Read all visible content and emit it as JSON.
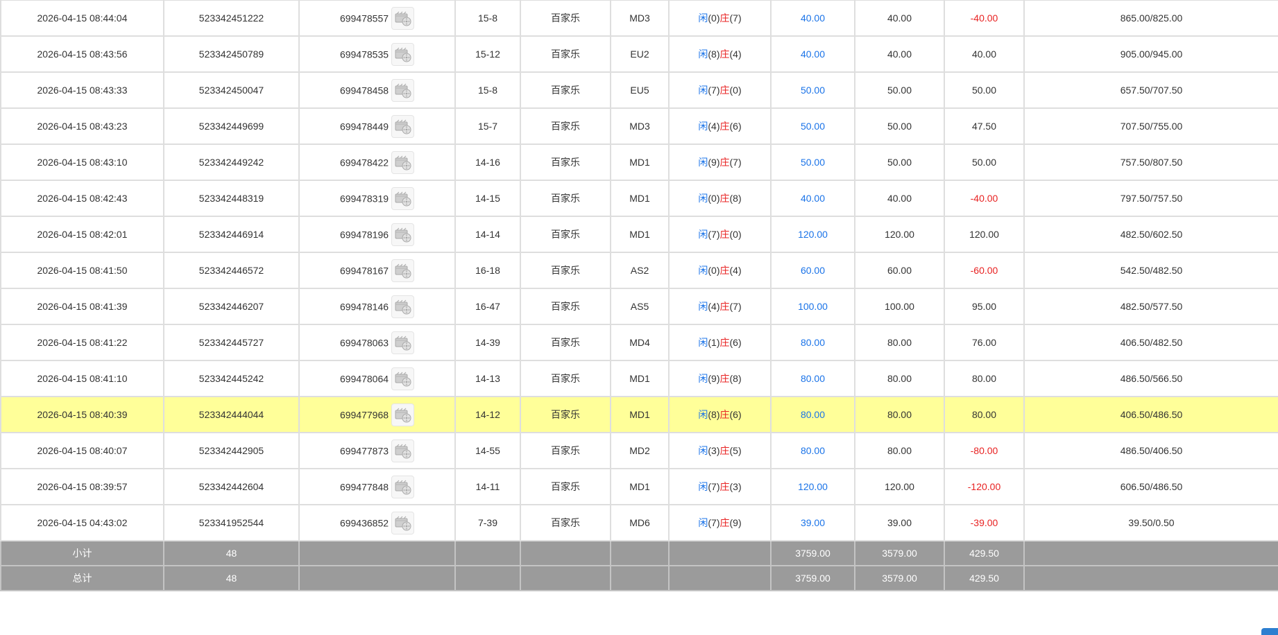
{
  "rows": [
    {
      "time": "2026-04-15 08:44:04",
      "order_id": "523342451222",
      "game_id": "699478557",
      "shoe": "15-8",
      "game": "百家乐",
      "table": "MD3",
      "player_label": "闲",
      "player_score": "(0)",
      "banker_label": "庄",
      "banker_score": "(7)",
      "bet": "40.00",
      "valid_bet": "40.00",
      "win_loss": "-40.00",
      "loss": true,
      "balance": "865.00/825.00"
    },
    {
      "time": "2026-04-15 08:43:56",
      "order_id": "523342450789",
      "game_id": "699478535",
      "shoe": "15-12",
      "game": "百家乐",
      "table": "EU2",
      "player_label": "闲",
      "player_score": "(8)",
      "banker_label": "庄",
      "banker_score": "(4)",
      "bet": "40.00",
      "valid_bet": "40.00",
      "win_loss": "40.00",
      "loss": false,
      "balance": "905.00/945.00"
    },
    {
      "time": "2026-04-15 08:43:33",
      "order_id": "523342450047",
      "game_id": "699478458",
      "shoe": "15-8",
      "game": "百家乐",
      "table": "EU5",
      "player_label": "闲",
      "player_score": "(7)",
      "banker_label": "庄",
      "banker_score": "(0)",
      "bet": "50.00",
      "valid_bet": "50.00",
      "win_loss": "50.00",
      "loss": false,
      "balance": "657.50/707.50"
    },
    {
      "time": "2026-04-15 08:43:23",
      "order_id": "523342449699",
      "game_id": "699478449",
      "shoe": "15-7",
      "game": "百家乐",
      "table": "MD3",
      "player_label": "闲",
      "player_score": "(4)",
      "banker_label": "庄",
      "banker_score": "(6)",
      "bet": "50.00",
      "valid_bet": "50.00",
      "win_loss": "47.50",
      "loss": false,
      "balance": "707.50/755.00"
    },
    {
      "time": "2026-04-15 08:43:10",
      "order_id": "523342449242",
      "game_id": "699478422",
      "shoe": "14-16",
      "game": "百家乐",
      "table": "MD1",
      "player_label": "闲",
      "player_score": "(9)",
      "banker_label": "庄",
      "banker_score": "(7)",
      "bet": "50.00",
      "valid_bet": "50.00",
      "win_loss": "50.00",
      "loss": false,
      "balance": "757.50/807.50"
    },
    {
      "time": "2026-04-15 08:42:43",
      "order_id": "523342448319",
      "game_id": "699478319",
      "shoe": "14-15",
      "game": "百家乐",
      "table": "MD1",
      "player_label": "闲",
      "player_score": "(0)",
      "banker_label": "庄",
      "banker_score": "(8)",
      "bet": "40.00",
      "valid_bet": "40.00",
      "win_loss": "-40.00",
      "loss": true,
      "balance": "797.50/757.50"
    },
    {
      "time": "2026-04-15 08:42:01",
      "order_id": "523342446914",
      "game_id": "699478196",
      "shoe": "14-14",
      "game": "百家乐",
      "table": "MD1",
      "player_label": "闲",
      "player_score": "(7)",
      "banker_label": "庄",
      "banker_score": "(0)",
      "bet": "120.00",
      "valid_bet": "120.00",
      "win_loss": "120.00",
      "loss": false,
      "balance": "482.50/602.50"
    },
    {
      "time": "2026-04-15 08:41:50",
      "order_id": "523342446572",
      "game_id": "699478167",
      "shoe": "16-18",
      "game": "百家乐",
      "table": "AS2",
      "player_label": "闲",
      "player_score": "(0)",
      "banker_label": "庄",
      "banker_score": "(4)",
      "bet": "60.00",
      "valid_bet": "60.00",
      "win_loss": "-60.00",
      "loss": true,
      "balance": "542.50/482.50"
    },
    {
      "time": "2026-04-15 08:41:39",
      "order_id": "523342446207",
      "game_id": "699478146",
      "shoe": "16-47",
      "game": "百家乐",
      "table": "AS5",
      "player_label": "闲",
      "player_score": "(4)",
      "banker_label": "庄",
      "banker_score": "(7)",
      "bet": "100.00",
      "valid_bet": "100.00",
      "win_loss": "95.00",
      "loss": false,
      "balance": "482.50/577.50"
    },
    {
      "time": "2026-04-15 08:41:22",
      "order_id": "523342445727",
      "game_id": "699478063",
      "shoe": "14-39",
      "game": "百家乐",
      "table": "MD4",
      "player_label": "闲",
      "player_score": "(1)",
      "banker_label": "庄",
      "banker_score": "(6)",
      "bet": "80.00",
      "valid_bet": "80.00",
      "win_loss": "76.00",
      "loss": false,
      "balance": "406.50/482.50"
    },
    {
      "time": "2026-04-15 08:41:10",
      "order_id": "523342445242",
      "game_id": "699478064",
      "shoe": "14-13",
      "game": "百家乐",
      "table": "MD1",
      "player_label": "闲",
      "player_score": "(9)",
      "banker_label": "庄",
      "banker_score": "(8)",
      "bet": "80.00",
      "valid_bet": "80.00",
      "win_loss": "80.00",
      "loss": false,
      "balance": "486.50/566.50"
    },
    {
      "time": "2026-04-15 08:40:39",
      "order_id": "523342444044",
      "game_id": "699477968",
      "shoe": "14-12",
      "game": "百家乐",
      "table": "MD1",
      "player_label": "闲",
      "player_score": "(8)",
      "banker_label": "庄",
      "banker_score": "(6)",
      "bet": "80.00",
      "valid_bet": "80.00",
      "win_loss": "80.00",
      "loss": false,
      "balance": "406.50/486.50",
      "highlighted": true
    },
    {
      "time": "2026-04-15 08:40:07",
      "order_id": "523342442905",
      "game_id": "699477873",
      "shoe": "14-55",
      "game": "百家乐",
      "table": "MD2",
      "player_label": "闲",
      "player_score": "(3)",
      "banker_label": "庄",
      "banker_score": "(5)",
      "bet": "80.00",
      "valid_bet": "80.00",
      "win_loss": "-80.00",
      "loss": true,
      "balance": "486.50/406.50"
    },
    {
      "time": "2026-04-15 08:39:57",
      "order_id": "523342442604",
      "game_id": "699477848",
      "shoe": "14-11",
      "game": "百家乐",
      "table": "MD1",
      "player_label": "闲",
      "player_score": "(7)",
      "banker_label": "庄",
      "banker_score": "(3)",
      "bet": "120.00",
      "valid_bet": "120.00",
      "win_loss": "-120.00",
      "loss": true,
      "balance": "606.50/486.50"
    },
    {
      "time": "2026-04-15 04:43:02",
      "order_id": "523341952544",
      "game_id": "699436852",
      "shoe": "7-39",
      "game": "百家乐",
      "table": "MD6",
      "player_label": "闲",
      "player_score": "(7)",
      "banker_label": "庄",
      "banker_score": "(9)",
      "bet": "39.00",
      "valid_bet": "39.00",
      "win_loss": "-39.00",
      "loss": true,
      "balance": "39.50/0.50"
    }
  ],
  "subtotal": {
    "label": "小计",
    "count": "48",
    "bet": "3759.00",
    "valid_bet": "3579.00",
    "win_loss": "429.50"
  },
  "total": {
    "label": "总计",
    "count": "48",
    "bet": "3759.00",
    "valid_bet": "3579.00",
    "win_loss": "429.50"
  },
  "icons": {
    "video": "video-replay-icon"
  },
  "colors": {
    "blue": "#1a73e8",
    "red": "#e82222",
    "highlight": "#ffff99",
    "summary_bg": "#9b9b9b"
  }
}
